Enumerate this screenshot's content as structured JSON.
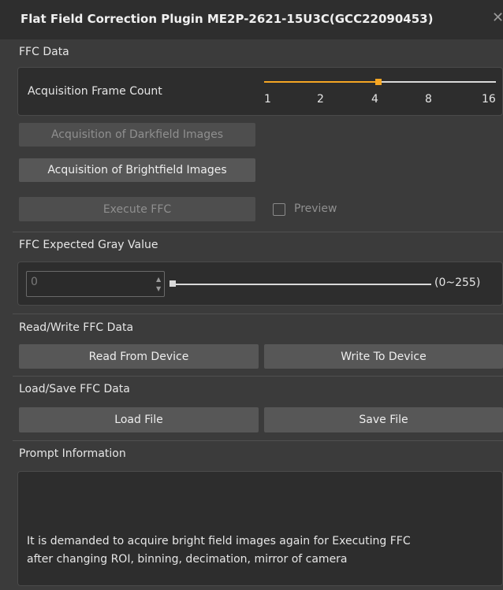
{
  "window": {
    "title": "Flat Field Correction Plugin  ME2P-2621-15U3C(GCC22090453)",
    "close_icon": "close-icon"
  },
  "ffc_data": {
    "section_label": "FFC Data",
    "frame_count_label": "Acquisition Frame Count",
    "frame_count_options": [
      "1",
      "2",
      "4",
      "8",
      "16"
    ],
    "frame_count_selected": "4",
    "accent_color": "#f5a623",
    "darkfield_button": "Acquisition of Darkfield Images",
    "brightfield_button": "Acquisition of Brightfield Images",
    "execute_button": "Execute FFC",
    "preview_label": "Preview"
  },
  "expected_gray": {
    "section_label": "FFC Expected Gray Value",
    "value": "0",
    "range_label": "(0~255)"
  },
  "read_write": {
    "section_label": "Read/Write FFC Data",
    "read_button": "Read From Device",
    "write_button": "Write To Device"
  },
  "load_save": {
    "section_label": "Load/Save FFC Data",
    "load_button": "Load File",
    "save_button": "Save File"
  },
  "prompt": {
    "section_label": "Prompt Information",
    "line1": "It is demanded to acquire bright field images again for Executing FFC",
    "line2": "after changing ROI, binning, decimation, mirror of camera"
  }
}
